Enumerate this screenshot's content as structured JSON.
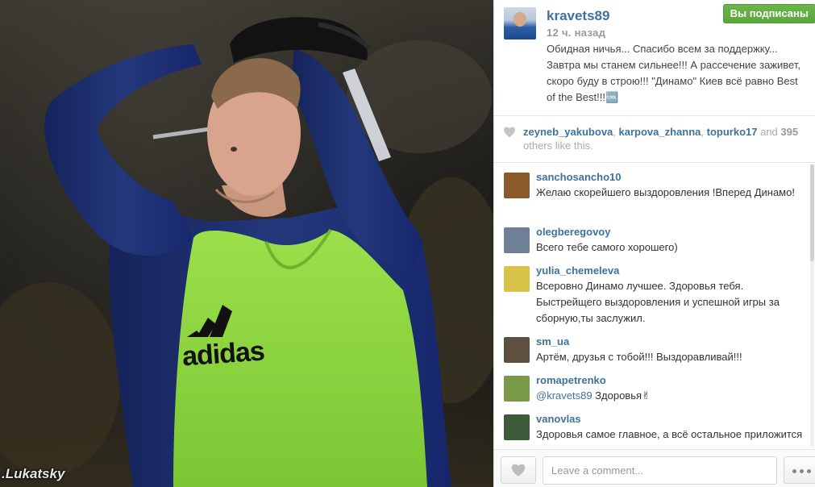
{
  "photo": {
    "credit": ".Lukatsky",
    "shirt_brand": "adidas"
  },
  "post": {
    "username": "kravets89",
    "time": "12 ч. назад",
    "follow_label": "Вы подписаны",
    "caption": "Обидная ничья... Спасибо всем за поддержку... Завтра мы станем сильнее!!! А рассечение заживет, скоро буду в строю!!! \"Динамо\" Киев всё равно Best of the Best!!!🆒"
  },
  "likes": {
    "users": [
      "zeyneb_yakubova",
      "karpova_zhanna",
      "topurko17"
    ],
    "and_label": "and",
    "count": "395",
    "suffix": "others like this."
  },
  "comments": [
    {
      "user": "sanchosancho10",
      "text": "Желаю скорейшего выздоровления !Вперед Динамо!",
      "avatar_color": "#8a5a2b"
    },
    {
      "user": "olegberegovoy",
      "text": "Всего тебе самого хорошего)",
      "avatar_color": "#6f7f96"
    },
    {
      "user": "yulia_chemeleva",
      "text": "Всеровно Динамо лучшее. Здоровья тебя. Быстрейщего выздоровления и успешной игры за сборную,ты заслужил.",
      "avatar_color": "#d9c24a"
    },
    {
      "user": "sm_ua",
      "text": "Артём, друзья с тобой!!! Выздоравливай!!!",
      "avatar_color": "#5e5040"
    },
    {
      "user": "romapetrenko",
      "mention": "@kravets89",
      "text": " Здоровья✌",
      "avatar_color": "#7a9a4a"
    },
    {
      "user": "vanovlas",
      "text": "Здоровья самое главное, а всё остальное приложится",
      "avatar_color": "#3d5a3a"
    }
  ],
  "footer": {
    "comment_placeholder": "Leave a comment..."
  },
  "colors": {
    "username_blue": "#3f729b",
    "follow_green": "#5aa73a",
    "bib_green": "#8fd63f",
    "jersey_navy": "#1e2f6e"
  },
  "icons": [
    "heart-icon",
    "like-heart-icon",
    "more-dots-icon"
  ]
}
